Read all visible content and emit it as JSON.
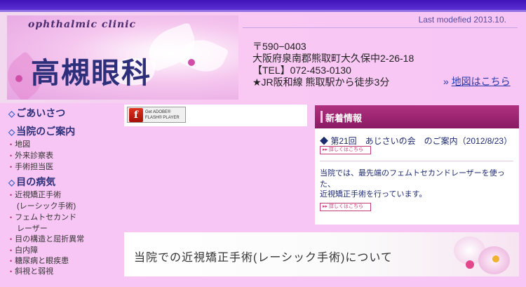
{
  "header": {
    "subtitle": "ophthalmic  clinic",
    "title": "高槻眼科",
    "last_modified": "Last modefied 2013.10."
  },
  "address": {
    "postal": "〒590−0403",
    "line1": "大阪府泉南郡熊取町大久保中2-26-18",
    "tel": "【TEL】072-453-0130",
    "access": "★JR阪和線 熊取駅から徒歩3分",
    "map_link": "地図はこちら",
    "map_link_arrow": "»"
  },
  "nav": {
    "greeting": "ごあいさつ",
    "guide": "当院のご案内",
    "guide_items": [
      "地図",
      "外来診察表",
      "手術担当医"
    ],
    "disease": "目の病気",
    "disease_items": [
      "近視矯正手術",
      "(レーシック手術)",
      "フェムトセカンド",
      "レーザー",
      "目の構造と屈折異常",
      "白内障",
      "糖尿病と眼疾患",
      "斜視と弱視"
    ],
    "arrow": "◇",
    "bullet": "•"
  },
  "flash": {
    "line1": "Get ADOBE®",
    "line2": "FLASH® PLAYER",
    "icon": "f"
  },
  "news": {
    "title": "新着情報",
    "item1": "◆ 第21回　あじさいの会　のご案内（2012/8/23）",
    "detail_label": "▸▸ 詳しくはこちら",
    "item2_line1": "当院では、最先端のフェムトセカンドレーザーを使った、",
    "item2_line2": "近視矯正手術を行っています。"
  },
  "banner": {
    "text": "当院での近視矯正手術(レーシック手術)について"
  },
  "colors": {
    "background": "#f8c6f4",
    "top_bar": "#3f13b8",
    "title": "#2d2f7a",
    "news_header": "#b0317f",
    "accent": "#c42d6f"
  }
}
